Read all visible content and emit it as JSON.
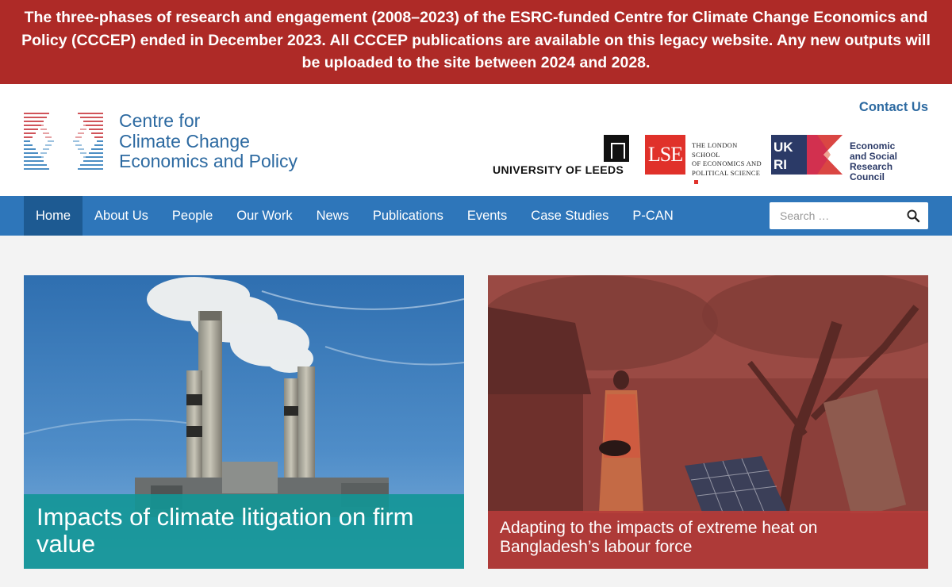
{
  "announcement": {
    "text": "The three-phases of research and engagement (2008–2023) of the ESRC-funded Centre for Climate Change Economics and Policy (CCCEP) ended in December 2023. All CCCEP publications are available on this legacy website. Any new outputs will be uploaded to the site between 2024 and 2028."
  },
  "header": {
    "brand_line1": "Centre for",
    "brand_line2": "Climate Change",
    "brand_line3": "Economics and Policy",
    "contact": "Contact Us",
    "partners": {
      "leeds": "UNIVERSITY OF LEEDS",
      "lse_mark": "LSE",
      "lse_line1": "The London School",
      "lse_line2": "of Economics and",
      "lse_line3": "Political Science",
      "ukri_mark": "UKRI",
      "ukri_line1": "Economic",
      "ukri_line2": "and Social",
      "ukri_line3": "Research Council"
    }
  },
  "nav": {
    "items": [
      {
        "label": "Home",
        "active": true
      },
      {
        "label": "About Us"
      },
      {
        "label": "People"
      },
      {
        "label": "Our Work"
      },
      {
        "label": "News"
      },
      {
        "label": "Publications"
      },
      {
        "label": "Events"
      },
      {
        "label": "Case Studies"
      },
      {
        "label": "P-CAN"
      }
    ],
    "search_placeholder": "Search …",
    "search_icon": "search-icon"
  },
  "features": [
    {
      "title": "Impacts of climate litigation on firm value",
      "image": "power-plant-smokestacks"
    },
    {
      "title": "Adapting to the impacts of extreme heat on Bangladesh’s labour force",
      "image": "woman-solar-panel-village"
    }
  ],
  "colors": {
    "banner": "#ae2a27",
    "brand_blue": "#2d6aa1",
    "nav": "#2e76ba",
    "nav_active": "#1d5a92",
    "caption_teal": "#129696",
    "caption_red": "#b43c3a"
  }
}
